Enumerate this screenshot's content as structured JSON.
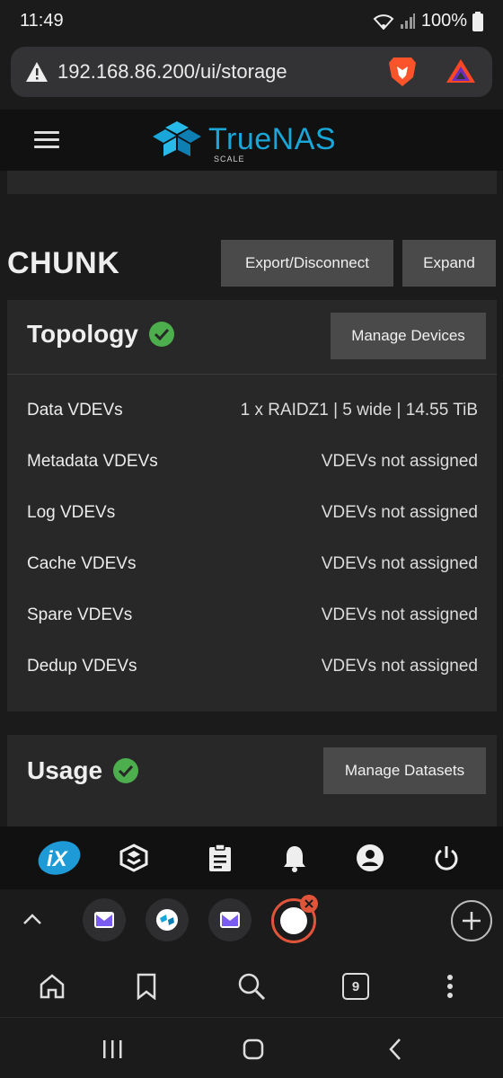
{
  "status_bar": {
    "time": "11:49",
    "battery": "100%"
  },
  "browser": {
    "url": "192.168.86.200/ui/storage",
    "tab_count": "9"
  },
  "app": {
    "brand": "TrueNAS",
    "edition": "SCALE"
  },
  "pool": {
    "name": "CHUNK",
    "export_label": "Export/Disconnect",
    "expand_label": "Expand"
  },
  "topology": {
    "title": "Topology",
    "manage_label": "Manage Devices",
    "rows": [
      {
        "label": "Data VDEVs",
        "value": "1 x RAIDZ1 | 5 wide | 14.55 TiB"
      },
      {
        "label": "Metadata VDEVs",
        "value": "VDEVs not assigned"
      },
      {
        "label": "Log VDEVs",
        "value": "VDEVs not assigned"
      },
      {
        "label": "Cache VDEVs",
        "value": "VDEVs not assigned"
      },
      {
        "label": "Spare VDEVs",
        "value": "VDEVs not assigned"
      },
      {
        "label": "Dedup VDEVs",
        "value": "VDEVs not assigned"
      }
    ]
  },
  "usage": {
    "title": "Usage",
    "manage_label": "Manage Datasets"
  },
  "colors": {
    "accent": "#19a6d8",
    "check": "#4cae4c",
    "button": "#4a4a4a",
    "card": "#282828"
  }
}
